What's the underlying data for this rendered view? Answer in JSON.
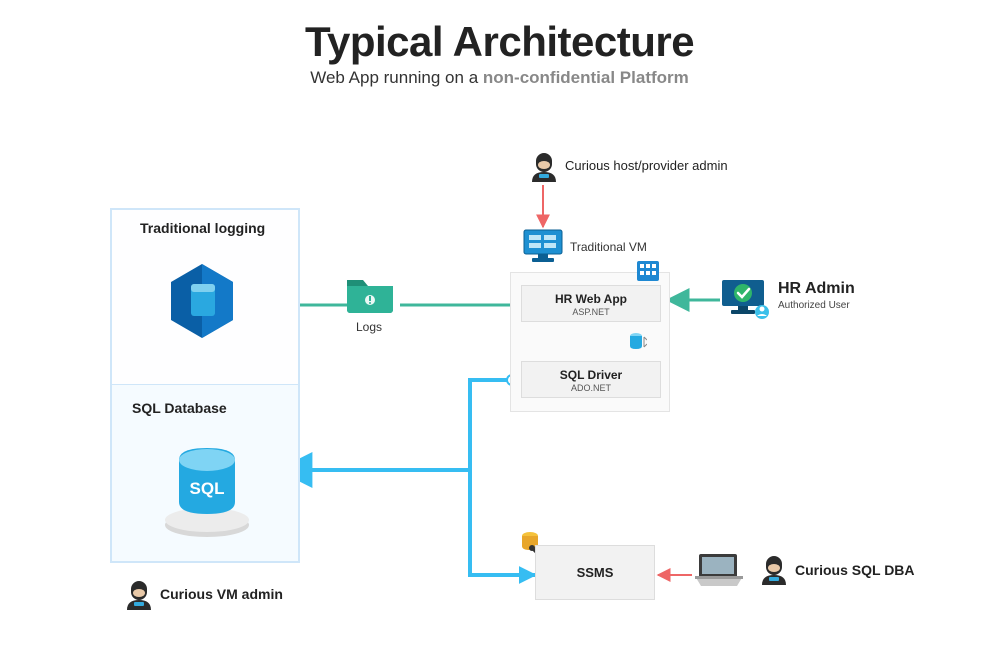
{
  "title": "Typical Architecture",
  "subtitle_pre": "Web App running on a ",
  "subtitle_em": "non-confidential Platform",
  "left_panel": {
    "logging_title": "Traditional logging",
    "db_title": "SQL Database",
    "db_badge": "SQL"
  },
  "logs_label": "Logs",
  "vm_group": {
    "header_label": "Traditional VM",
    "web_app": {
      "title": "HR Web App",
      "sub": "ASP.NET"
    },
    "sql_driver": {
      "title": "SQL Driver",
      "sub": "ADO.NET"
    }
  },
  "ssms_label": "SSMS",
  "actors": {
    "host_admin": "Curious host/provider admin",
    "hr_admin_title": "HR Admin",
    "hr_admin_sub": "Authorized User",
    "vm_admin": "Curious VM admin",
    "sql_dba": "Curious SQL DBA"
  }
}
